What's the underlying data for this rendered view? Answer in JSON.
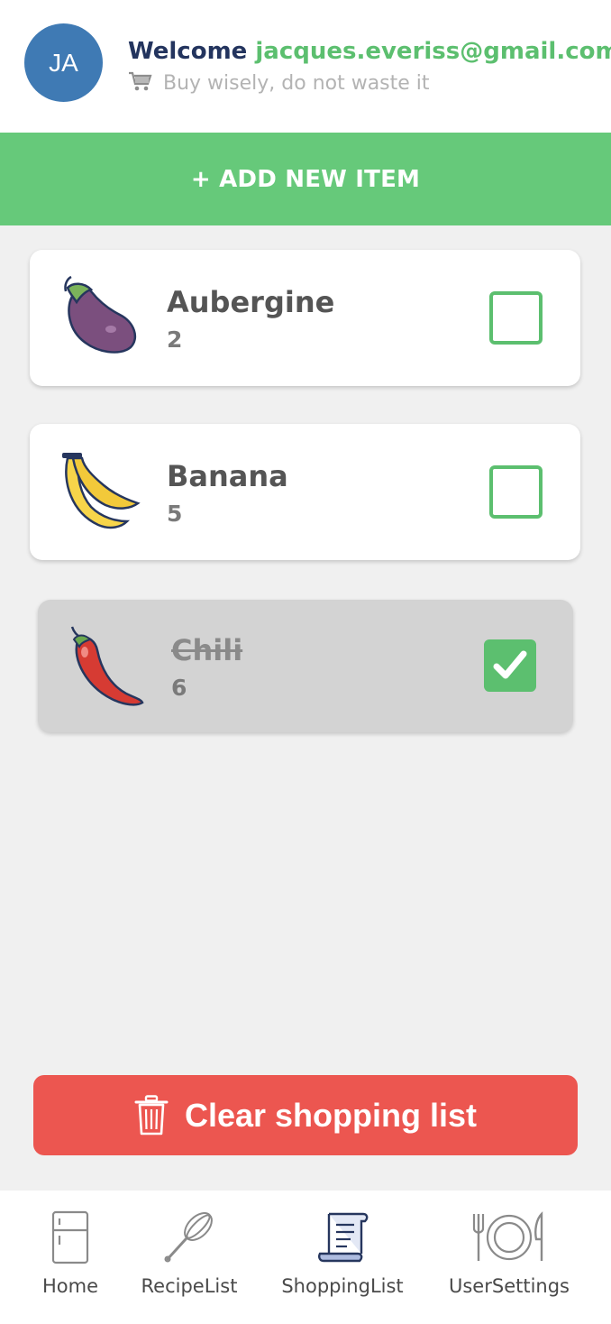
{
  "header": {
    "avatar_initials": "JA",
    "welcome": "Welcome",
    "email": "jacques.everiss@gmail.com",
    "tagline": "Buy wisely, do not waste it"
  },
  "add_button": {
    "label": "+ ADD NEW ITEM"
  },
  "items": [
    {
      "name": "Aubergine",
      "quantity": "2",
      "icon": "aubergine-icon",
      "checked": false
    },
    {
      "name": "Banana",
      "quantity": "5",
      "icon": "banana-icon",
      "checked": false
    },
    {
      "name": "Chili",
      "quantity": "6",
      "icon": "chili-icon",
      "checked": true
    }
  ],
  "clear_button": {
    "label": "Clear shopping list",
    "icon": "trash-icon"
  },
  "nav": [
    {
      "label": "Home",
      "icon": "fridge-icon"
    },
    {
      "label": "RecipeList",
      "icon": "whisk-icon"
    },
    {
      "label": "ShoppingList",
      "icon": "receipt-icon"
    },
    {
      "label": "UserSettings",
      "icon": "plate-cutlery-icon"
    }
  ],
  "colors": {
    "accent_green": "#66c97a",
    "danger_red": "#ec5650",
    "avatar_blue": "#3f7ab4",
    "welcome_navy": "#23345e"
  }
}
